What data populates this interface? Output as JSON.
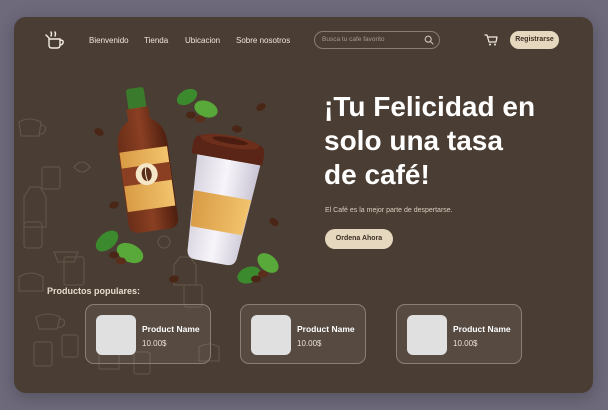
{
  "nav": {
    "links": [
      "Bienvenido",
      "Tienda",
      "Ubicacion",
      "Sobre nosotros"
    ],
    "search_placeholder": "Busca tu cafe favorito",
    "register_label": "Registrarse"
  },
  "hero": {
    "title_line1": "¡Tu Felicidad en",
    "title_line2": "solo una tasa",
    "title_line3": "de café!",
    "subtitle": "El Café es la mejor parte de despertarse.",
    "cta_label": "Ordena Ahora"
  },
  "popular": {
    "label": "Productos populares:",
    "products": [
      {
        "name": "Product Name",
        "price": "10.00$"
      },
      {
        "name": "Product Name",
        "price": "10.00$"
      },
      {
        "name": "Product Name",
        "price": "10.00$"
      }
    ]
  },
  "colors": {
    "page_bg": "#6e6a7c",
    "panel_bg": "#4a3d33",
    "accent": "#e6d8be",
    "text": "#ffffff"
  },
  "icons": {
    "logo": "coffee-pot-icon",
    "search": "search-icon",
    "cart": "cart-icon"
  }
}
